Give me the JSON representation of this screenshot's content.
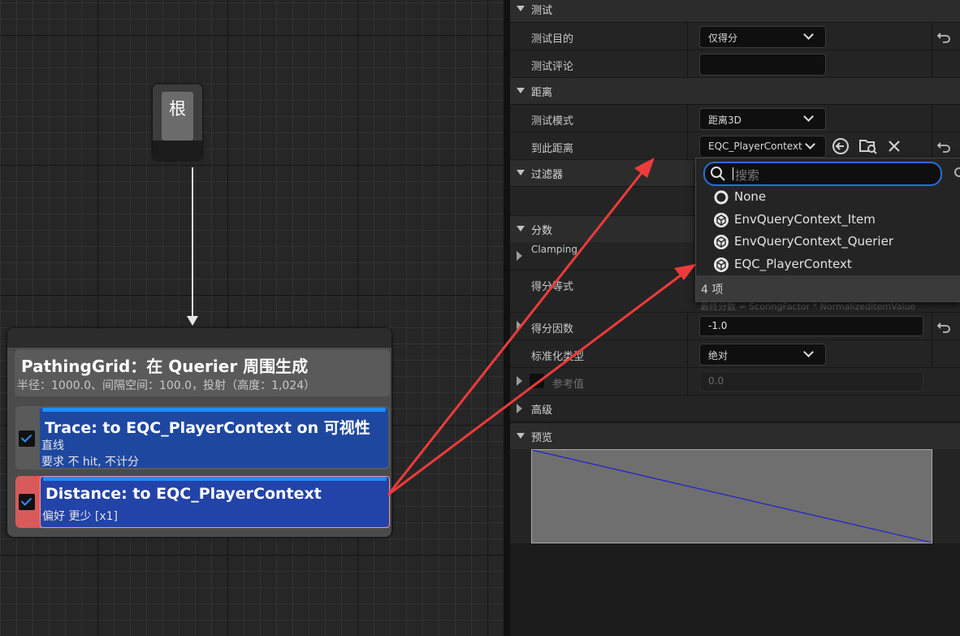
{
  "graph": {
    "root_label": "根",
    "generator": {
      "title": "PathingGrid：在 Querier 周围生成",
      "subtitle": "半径：1000.0、间隔空间：100.0，投射（高度：1,024）"
    },
    "tests": [
      {
        "title": "Trace: to EQC_PlayerContext on 可视性",
        "line1": "直线",
        "line2": "要求 不 hit, 不计分",
        "checked": true
      },
      {
        "title": "Distance: to EQC_PlayerContext",
        "line1": "偏好 更少 [x1]",
        "checked": true,
        "selected": true
      }
    ]
  },
  "details": {
    "cat_test": "测试",
    "test_purpose_label": "测试目的",
    "test_purpose_value": "仅得分",
    "test_comment_label": "测试评论",
    "test_comment_value": "",
    "cat_distance": "距离",
    "test_mode_label": "测试模式",
    "test_mode_value": "距离3D",
    "distance_to_label": "到此距离",
    "distance_to_value": "EQC_PlayerContext",
    "cat_filter": "过滤器",
    "cat_score": "分数",
    "clamping_label": "Clamping",
    "score_equation_label": "得分等式",
    "score_hint": "最终分数 = ScoringFactor * NormalizedItemValue",
    "score_factor_label": "得分因数",
    "score_factor_value": "-1.0",
    "normalization_label": "标准化类型",
    "normalization_value": "绝对",
    "reference_label": "参考值",
    "reference_value": "0.0",
    "cat_advanced": "高级",
    "cat_preview": "预览"
  },
  "dropdown": {
    "search_placeholder": "搜索",
    "items": [
      "None",
      "EnvQueryContext_Item",
      "EnvQueryContext_Querier",
      "EQC_PlayerContext"
    ],
    "footer": "4 项"
  },
  "colors": {
    "accent": "#2a6ed8",
    "annotation": "#ee3b3b",
    "test_blue": "#1e48a0",
    "selected_red": "#d85a5a"
  }
}
